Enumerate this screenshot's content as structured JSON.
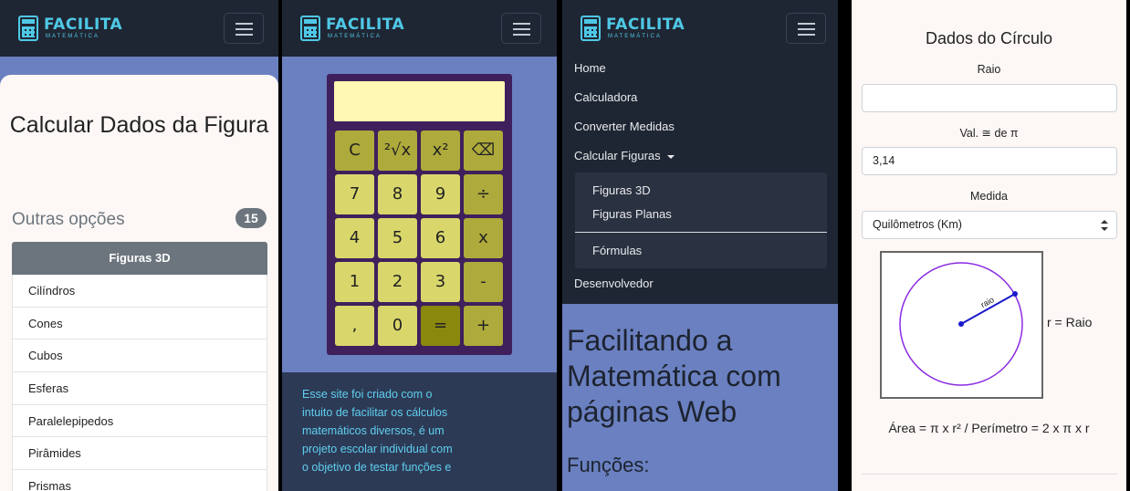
{
  "brand": {
    "name": "FACILITA",
    "subtitle": "MATEMÁTICA",
    "color": "#4fc8e6"
  },
  "icons": {
    "brand": "calculator-icon",
    "menu": "hamburger-icon",
    "caret": "caret-down-icon",
    "select": "select-arrows-icon"
  },
  "panel1": {
    "title": "Calcular Dados da Figura",
    "other_heading": "Outras opções",
    "count_badge": "15",
    "list_header": "Figuras 3D",
    "items": [
      "Cilíndros",
      "Cones",
      "Cubos",
      "Esferas",
      "Paralelepipedos",
      "Pirâmides",
      "Prismas"
    ]
  },
  "panel2": {
    "keys": [
      {
        "label": "C",
        "kind": "op"
      },
      {
        "label": "²√x",
        "kind": "op"
      },
      {
        "label": "x²",
        "kind": "op"
      },
      {
        "label": "⌫",
        "kind": "op"
      },
      {
        "label": "7",
        "kind": "num"
      },
      {
        "label": "8",
        "kind": "num"
      },
      {
        "label": "9",
        "kind": "num"
      },
      {
        "label": "÷",
        "kind": "op"
      },
      {
        "label": "4",
        "kind": "num"
      },
      {
        "label": "5",
        "kind": "num"
      },
      {
        "label": "6",
        "kind": "num"
      },
      {
        "label": "x",
        "kind": "op"
      },
      {
        "label": "1",
        "kind": "num"
      },
      {
        "label": "2",
        "kind": "num"
      },
      {
        "label": "3",
        "kind": "num"
      },
      {
        "label": "-",
        "kind": "op"
      },
      {
        "label": ",",
        "kind": "num"
      },
      {
        "label": "0",
        "kind": "num"
      },
      {
        "label": "=",
        "kind": "eq"
      },
      {
        "label": "+",
        "kind": "op"
      }
    ],
    "footer_text": "Esse site foi criado com o intuito de facilitar os cálculos matemáticos diversos, é um projeto escolar individual com o objetivo de testar funções e"
  },
  "panel3": {
    "menu": {
      "home": "Home",
      "calculadora": "Calculadora",
      "converter": "Converter Medidas",
      "calcular_figuras": "Calcular Figuras",
      "sub_3d": "Figuras 3D",
      "sub_planas": "Figuras Planas",
      "sub_formulas": "Fórmulas",
      "desenvolvedor": "Desenvolvedor"
    },
    "hero_line1": "Facilitando a",
    "hero_line2": "Matemática com",
    "hero_line3": "páginas Web",
    "funcoes": "Funções:"
  },
  "panel4": {
    "title": "Dados do Círculo",
    "raio_label": "Raio",
    "raio_value": "",
    "pi_label": "Val. ≅ de π",
    "pi_value": "3,14",
    "medida_label": "Medida",
    "medida_value": "Quilômetros (Km)",
    "diagram_radius_label": "raio",
    "r_legend": "r = Raio",
    "formula": "Área = π x r² / Perímetro = 2 x π x r"
  }
}
